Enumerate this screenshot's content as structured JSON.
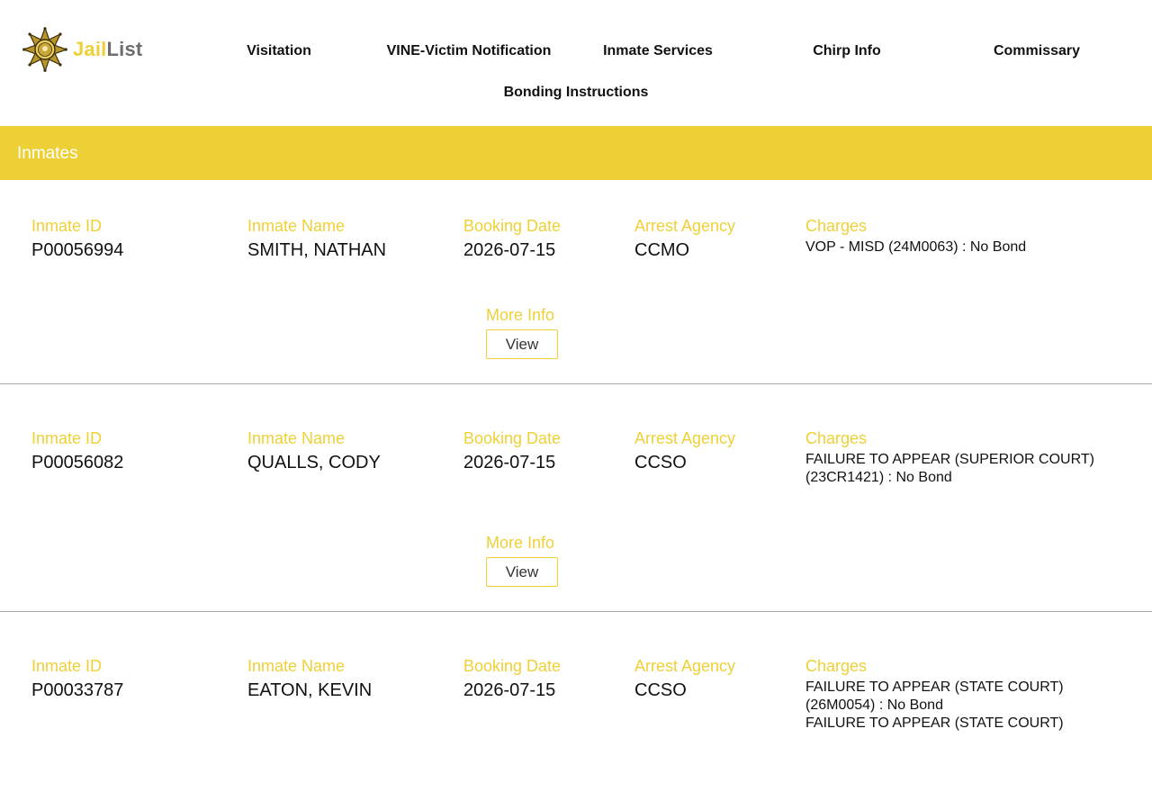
{
  "brand": {
    "part1": "Jail",
    "part2": "List",
    "logo_icon": "sheriff-star-badge",
    "accent_color": "#EFD036"
  },
  "nav": {
    "items": [
      {
        "label": "Visitation"
      },
      {
        "label": "VINE-Victim Notification"
      },
      {
        "label": "Inmate Services"
      },
      {
        "label": "Chirp Info"
      },
      {
        "label": "Commissary"
      },
      {
        "label": "Bonding Instructions"
      }
    ]
  },
  "banner": {
    "title": "Inmates",
    "color": "#EDD036"
  },
  "labels": {
    "inmate_id": "Inmate ID",
    "inmate_name": "Inmate Name",
    "booking_date": "Booking Date",
    "arrest_agency": "Arrest Agency",
    "charges": "Charges",
    "more_info": "More Info",
    "view_button": "View"
  },
  "inmates": [
    {
      "id": "P00056994",
      "name": "SMITH, NATHAN",
      "booking_date": "2026-07-15",
      "agency": "CCMO",
      "charges": [
        "VOP - MISD (24M0063) : No Bond"
      ]
    },
    {
      "id": "P00056082",
      "name": "QUALLS, CODY",
      "booking_date": "2026-07-15",
      "agency": "CCSO",
      "charges": [
        "FAILURE TO APPEAR (SUPERIOR COURT) (23CR1421) : No Bond"
      ]
    },
    {
      "id": "P00033787",
      "name": "EATON, KEVIN",
      "booking_date": "2026-07-15",
      "agency": "CCSO",
      "charges": [
        "FAILURE TO APPEAR (STATE COURT) (26M0054) : No Bond",
        "FAILURE TO APPEAR (STATE COURT)"
      ]
    }
  ]
}
